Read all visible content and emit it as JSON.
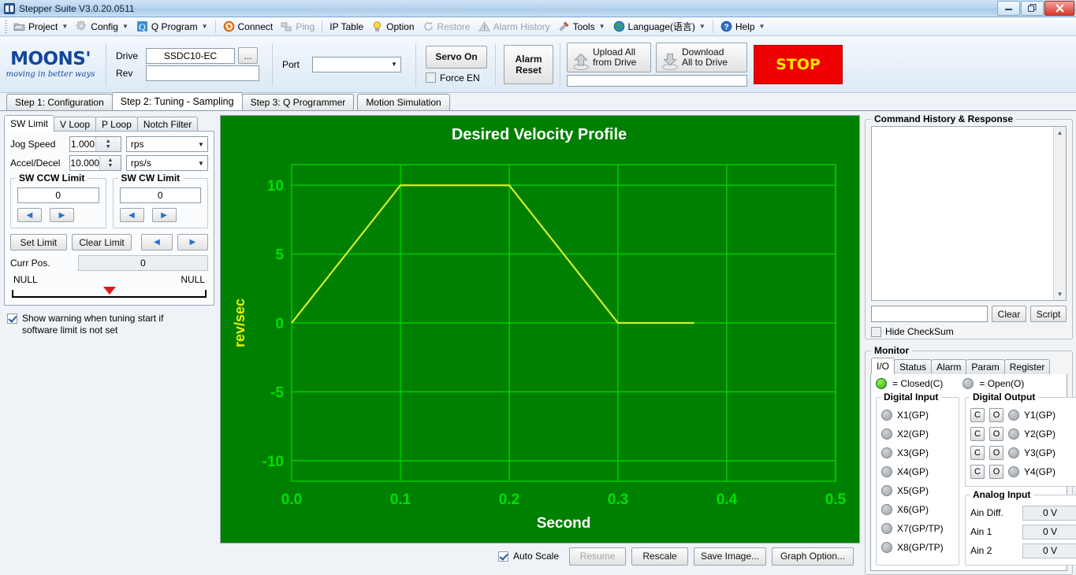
{
  "window": {
    "title": "Stepper Suite V3.0.20.0511",
    "ghost_title_1": "3Whatever.tgw.docx - Microsoft Word",
    "ghost_title_2": "Microsoft Word",
    "minimize": "–",
    "restore": "❐",
    "close": "✕"
  },
  "toolbar": {
    "items": [
      {
        "label": "Project",
        "icon": "project-icon",
        "has_caret": true,
        "disabled": false
      },
      {
        "label": "Config",
        "icon": "gear-icon",
        "has_caret": true,
        "disabled": false
      },
      {
        "label": "Q Program",
        "icon": "q-icon",
        "has_caret": true,
        "disabled": false
      },
      {
        "label": "Connect",
        "icon": "connect-icon",
        "has_caret": false,
        "disabled": false
      },
      {
        "label": "Ping",
        "icon": "ping-icon",
        "has_caret": false,
        "disabled": true
      },
      {
        "label": "IP Table",
        "icon": "ip-table-icon",
        "has_caret": false,
        "disabled": false
      },
      {
        "label": "Option",
        "icon": "bulb-icon",
        "has_caret": false,
        "disabled": false
      },
      {
        "label": "Restore",
        "icon": "restore-icon",
        "has_caret": false,
        "disabled": true
      },
      {
        "label": "Alarm History",
        "icon": "warning-icon",
        "has_caret": false,
        "disabled": true
      },
      {
        "label": "Tools",
        "icon": "tools-icon",
        "has_caret": true,
        "disabled": false
      },
      {
        "label": "Language(语言)",
        "icon": "globe-icon",
        "has_caret": true,
        "disabled": false
      },
      {
        "label": "Help",
        "icon": "help-icon",
        "has_caret": true,
        "disabled": false
      }
    ]
  },
  "drivebar": {
    "logo_main": "MOONS'",
    "logo_tag": "moving in better ways",
    "drive_label": "Drive",
    "drive_value": "SSDC10-EC",
    "browse_label": "...",
    "rev_label": "Rev",
    "rev_value": "",
    "port_label": "Port",
    "port_value": "",
    "servo_on": "Servo On",
    "force_en": "Force EN",
    "force_en_checked": false,
    "alarm_reset": "Alarm\nReset",
    "alarm_reset_l1": "Alarm",
    "alarm_reset_l2": "Reset",
    "upload_l1": "Upload All",
    "upload_l2": "from Drive",
    "download_l1": "Download",
    "download_l2": "All to Drive",
    "progress_value": "",
    "stop_label": "STOP"
  },
  "step_tabs": [
    {
      "label": "Step 1: Configuration",
      "active": false
    },
    {
      "label": "Step 2: Tuning - Sampling",
      "active": true
    },
    {
      "label": "Step 3: Q Programmer",
      "active": false
    },
    {
      "label": "Motion Simulation",
      "active": false
    }
  ],
  "left_panel": {
    "tabs": [
      {
        "label": "SW Limit",
        "active": true
      },
      {
        "label": "V Loop",
        "active": false
      },
      {
        "label": "P Loop",
        "active": false
      },
      {
        "label": "Notch Filter",
        "active": false
      }
    ],
    "jog_speed_label": "Jog Speed",
    "jog_speed_value": "1.000",
    "jog_speed_unit": "rps",
    "accel_label": "Accel/Decel",
    "accel_value": "10.000",
    "accel_unit": "rps/s",
    "ccw_title": "SW CCW Limit",
    "ccw_value": "0",
    "cw_title": "SW CW Limit",
    "cw_value": "0",
    "set_limit": "Set Limit",
    "clear_limit": "Clear Limit",
    "curr_pos_label": "Curr Pos.",
    "curr_pos_value": "0",
    "null_left": "NULL",
    "null_right": "NULL",
    "warn_line1": "Show warning when tuning start if",
    "warn_line2": "software limit is not set",
    "warn_checked": true
  },
  "graph_controls": {
    "auto_scale": "Auto Scale",
    "auto_scale_checked": true,
    "resume": "Resume",
    "resume_disabled": true,
    "rescale": "Rescale",
    "save_image": "Save Image...",
    "graph_option": "Graph Option..."
  },
  "command_history": {
    "title": "Command History & Response",
    "log_text": "",
    "input_value": "",
    "clear": "Clear",
    "script": "Script",
    "hide_checksum": "Hide CheckSum",
    "hide_checksum_checked": false
  },
  "monitor": {
    "title": "Monitor",
    "tabs": [
      {
        "label": "I/O",
        "active": true
      },
      {
        "label": "Status",
        "active": false
      },
      {
        "label": "Alarm",
        "active": false
      },
      {
        "label": "Param",
        "active": false
      },
      {
        "label": "Register",
        "active": false
      }
    ],
    "legend_closed": "= Closed(C)",
    "legend_open": "= Open(O)",
    "digital_input_title": "Digital Input",
    "digital_inputs": [
      {
        "label": "X1(GP)",
        "state": "open"
      },
      {
        "label": "X2(GP)",
        "state": "open"
      },
      {
        "label": "X3(GP)",
        "state": "open"
      },
      {
        "label": "X4(GP)",
        "state": "open"
      },
      {
        "label": "X5(GP)",
        "state": "open"
      },
      {
        "label": "X6(GP)",
        "state": "open"
      },
      {
        "label": "X7(GP/TP)",
        "state": "open"
      },
      {
        "label": "X8(GP/TP)",
        "state": "open"
      }
    ],
    "digital_output_title": "Digital Output",
    "btn_c": "C",
    "btn_o": "O",
    "digital_outputs": [
      {
        "label": "Y1(GP)",
        "state": "open"
      },
      {
        "label": "Y2(GP)",
        "state": "open"
      },
      {
        "label": "Y3(GP)",
        "state": "open"
      },
      {
        "label": "Y4(GP)",
        "state": "open"
      }
    ],
    "analog_input_title": "Analog Input",
    "analog_inputs": [
      {
        "label": "Ain Diff.",
        "value": "0 V"
      },
      {
        "label": "Ain 1",
        "value": "0 V"
      },
      {
        "label": "Ain 2",
        "value": "0 V"
      }
    ]
  },
  "colors": {
    "plot_bg": "#008000",
    "grid": "#00d000",
    "trace": "#d4ee26",
    "axis_text": "#00e000",
    "title_text": "#ffffff",
    "ylabel_text": "#e8f000",
    "stop_bg": "#ef0000",
    "stop_fg": "#ffe400",
    "brand": "#12479b"
  },
  "chart_data": {
    "type": "line",
    "title": "Desired Velocity Profile",
    "xlabel": "Second",
    "ylabel": "rev/sec",
    "xlim": [
      0.0,
      0.5
    ],
    "ylim": [
      -11.5,
      11.5
    ],
    "xticks": [
      "0.0",
      "0.1",
      "0.2",
      "0.3",
      "0.4",
      "0.5"
    ],
    "xtick_values": [
      0.0,
      0.1,
      0.2,
      0.3,
      0.4,
      0.5
    ],
    "yticks": [
      "10",
      "5",
      "0",
      "-5",
      "-10"
    ],
    "ytick_values": [
      10,
      5,
      0,
      -5,
      -10
    ],
    "grid": true,
    "legend": false,
    "series": [
      {
        "name": "Desired Velocity",
        "color": "#d4ee26",
        "x": [
          0.0,
          0.1,
          0.2,
          0.3,
          0.37
        ],
        "y": [
          0.0,
          10.0,
          10.0,
          0.0,
          0.0
        ]
      }
    ]
  }
}
